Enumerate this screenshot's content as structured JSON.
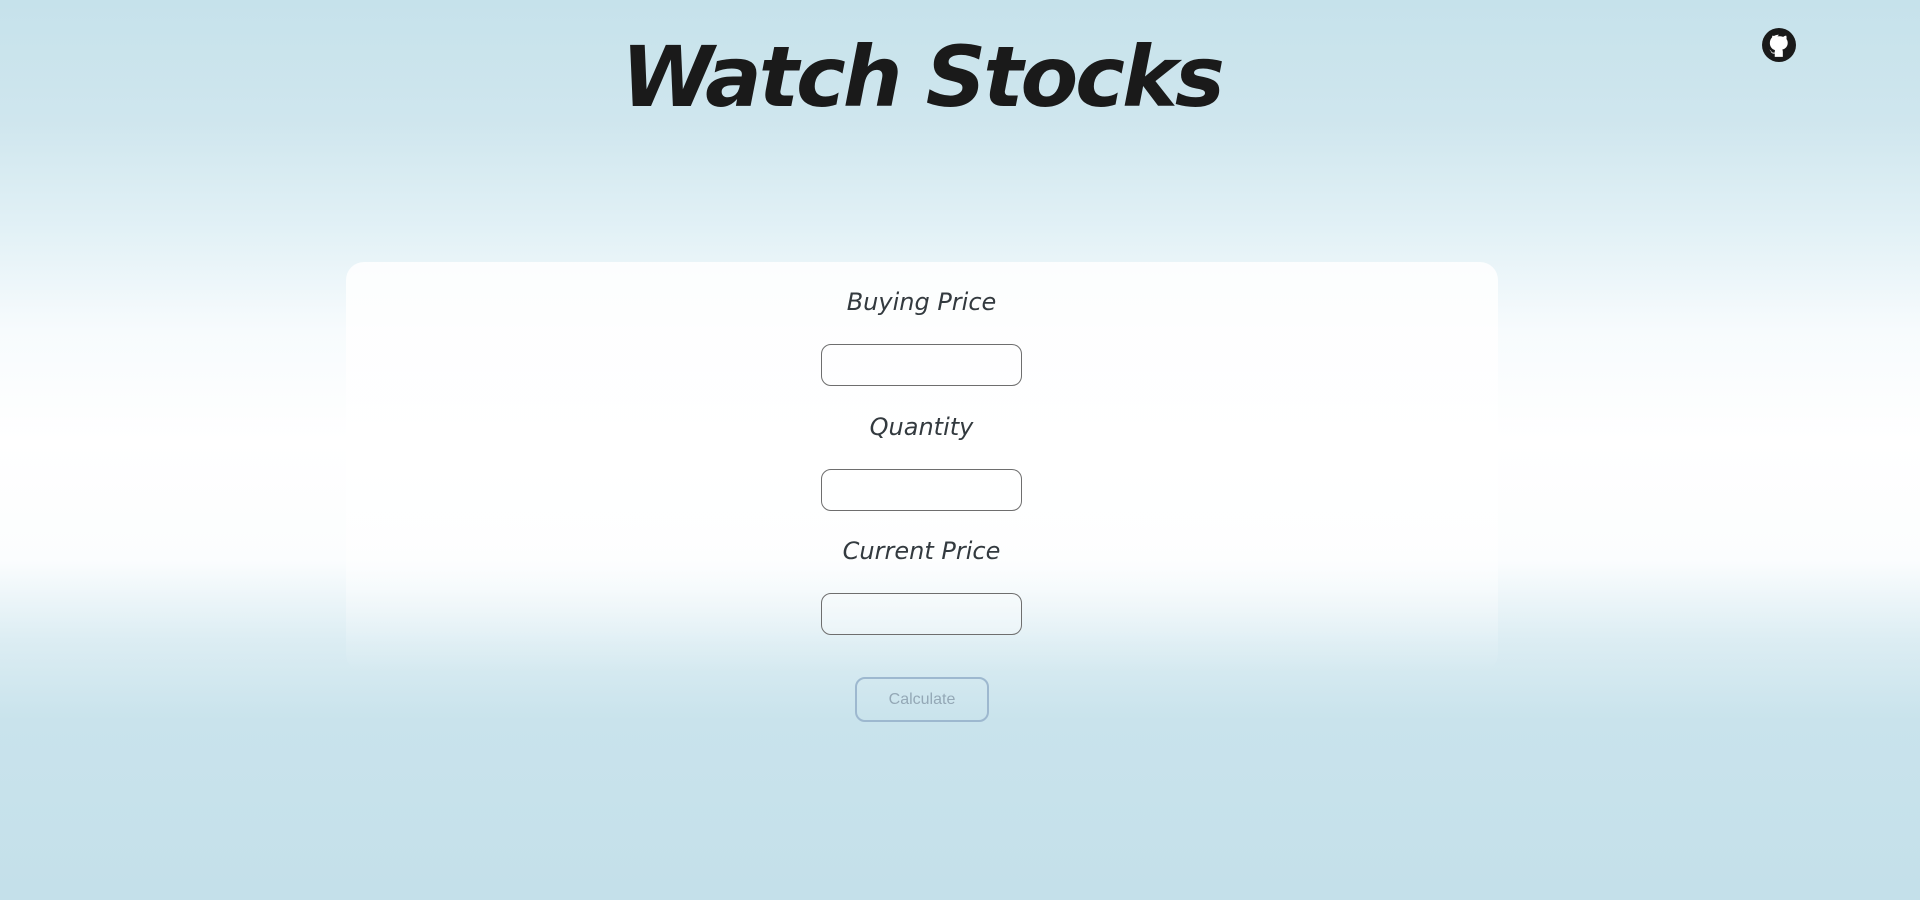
{
  "header": {
    "title": "Watch Stocks",
    "github_icon": "github-icon"
  },
  "form": {
    "buying_price_label": "Buying Price",
    "buying_price_value": "",
    "quantity_label": "Quantity",
    "quantity_value": "",
    "current_price_label": "Current Price",
    "current_price_value": "",
    "calculate_label": "Calculate"
  },
  "colors": {
    "background_top": "#c6e2eb",
    "background_mid": "#ffffff",
    "title": "#1a1a1a",
    "button_border": "#9db8cf",
    "button_text": "#94a8b6"
  }
}
